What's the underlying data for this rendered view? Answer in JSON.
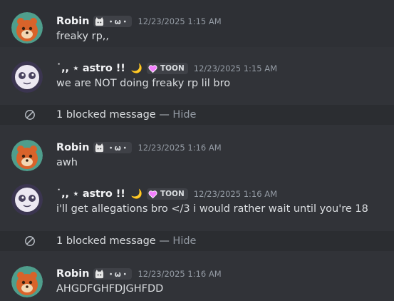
{
  "messages": [
    {
      "username": "Robin",
      "tag": "・ω・",
      "timestamp": "12/23/2025 1:15 AM",
      "content": "freaky rp,,"
    },
    {
      "username": "˙,, ⋆ astro !!",
      "decoration": "🌙",
      "tag": "TOON",
      "timestamp": "12/23/2025 1:15 AM",
      "content": "we are NOT doing freaky rp lil bro"
    },
    {
      "blocked_label": "1 blocked message",
      "separator": "—",
      "hide_label": "Hide"
    },
    {
      "username": "Robin",
      "tag": "・ω・",
      "timestamp": "12/23/2025 1:16 AM",
      "content": "awh"
    },
    {
      "username": "˙,, ⋆ astro !!",
      "decoration": "🌙",
      "tag": "TOON",
      "timestamp": "12/23/2025 1:16 AM",
      "content": "i'll get allegations bro </3 i would rather wait until you're 18"
    },
    {
      "blocked_label": "1 blocked message",
      "separator": "—",
      "hide_label": "Hide"
    },
    {
      "username": "Robin",
      "tag": "・ω・",
      "timestamp": "12/23/2025 1:16 AM",
      "content": "AHGDFGHFDJGHFDD"
    }
  ],
  "colors": {
    "background": "#313338",
    "blocked_row": "#2b2d31",
    "username": "#f2f3f5",
    "timestamp": "#949ba4",
    "tag_background": "#3f4147",
    "toon_heart": "#f47fff"
  },
  "icons": {
    "robin_tag": "cat-icon",
    "astro_tag": "heart-icon",
    "blocked": "blocked-icon"
  }
}
